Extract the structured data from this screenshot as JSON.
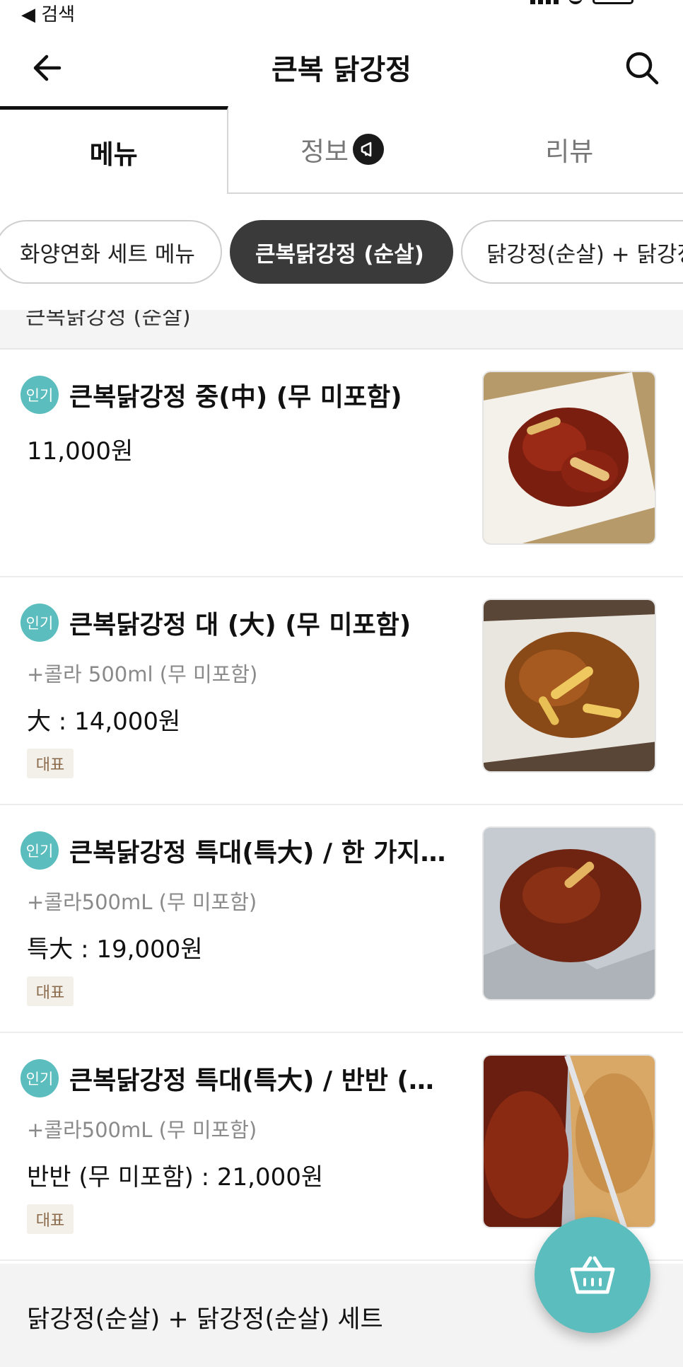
{
  "status_bar": {
    "back_text": "◀ 검색"
  },
  "header": {
    "title": "큰복 닭강정"
  },
  "tabs": [
    {
      "label": "메뉴",
      "active": true
    },
    {
      "label": "정보",
      "active": false
    },
    {
      "label": "리뷰",
      "active": false
    }
  ],
  "categories": [
    {
      "label": "화양연화 세트 메뉴",
      "active": false
    },
    {
      "label": "큰복닭강정 (순살)",
      "active": true
    },
    {
      "label": "닭강정(순살) + 닭강정",
      "active": false
    }
  ],
  "section_partial": "큰복닭강정 (순살)",
  "popular_badge": "인기",
  "rep_tag": "대표",
  "items": [
    {
      "name": "큰복닭강정 중(中) (무 미포함)",
      "desc": "",
      "price": "11,000원",
      "rep": false
    },
    {
      "name": "큰복닭강정 대 (大) (무 미포함)",
      "desc": "+콜라 500ml (무 미포함)",
      "price": "大 : 14,000원",
      "rep": true
    },
    {
      "name": "큰복닭강정 특대(특大) / 한 가지…",
      "desc": "+콜라500mL (무 미포함)",
      "price": "특大 : 19,000원",
      "rep": true
    },
    {
      "name": "큰복닭강정 특대(특大) / 반반 (무…",
      "desc": "+콜라500mL (무 미포함)",
      "price": "반반 (무 미포함) : 21,000원",
      "rep": true
    }
  ],
  "next_section": "닭강정(순살) + 닭강정(순살) 세트",
  "colors": {
    "accent": "#5bbdbd",
    "chip_active": "#3a3a3a",
    "rep_tag_bg": "#f3efe9"
  }
}
